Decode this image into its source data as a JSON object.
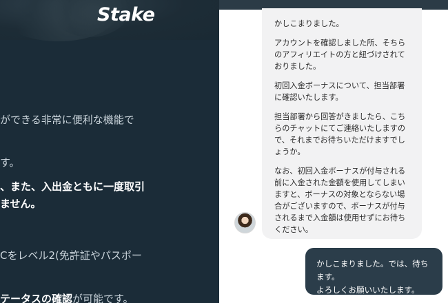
{
  "background_page": {
    "logo_text": "Stake",
    "lines": [
      "ができる非常に便利な機能で",
      "す。",
      "、また、入出金ともに一度取引",
      "ません。",
      "Cをレベル2(免許証やパスポー"
    ],
    "last_line": {
      "link_text": "テータスの確認",
      "suffix": "が可能です。"
    }
  },
  "chat": {
    "agent_message": [
      "かしこまりました。",
      "アカウントを確認しました所、そちらのアフィリエイトの方と紐づけされておりました。",
      "初回入金ボーナスについて、担当部署に確認いたします。",
      "担当部署から回答がきましたら、こちらのチャットにてご連絡いたしますので、それまでお待ちいただけますでしょうか。",
      "なお、初回入金ボーナスが付与される前に入金された金額を使用してしまいますと、ボーナスの対象とならない場合がございますので、ボーナスが付与されるまで入金額は使用せずにお待ちください。"
    ],
    "user_message": [
      "かしこまりました。では、待ちます。",
      "よろしくお願いいたします。"
    ]
  },
  "colors": {
    "left_background": "#1b2c38",
    "user_bubble": "#2b3d4a",
    "agent_bubble": "#f2f2f3"
  }
}
